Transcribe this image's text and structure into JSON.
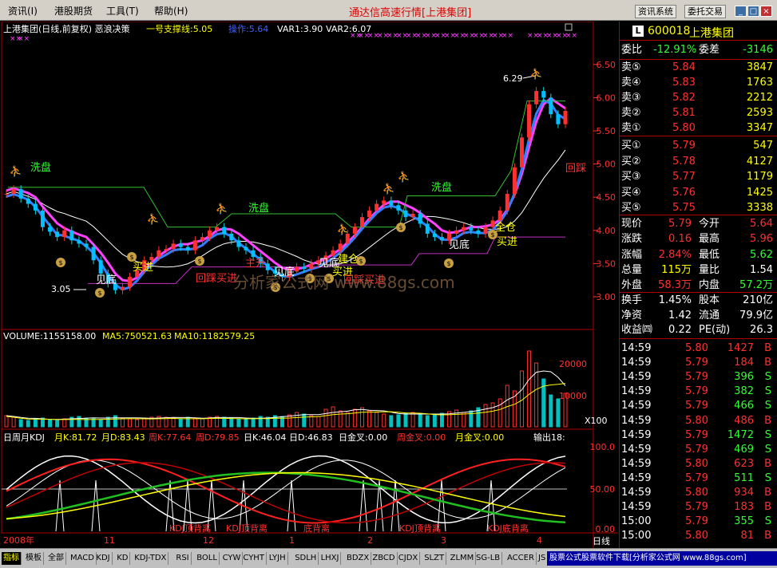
{
  "menubar": {
    "items": [
      "资讯(I)",
      "港股期货",
      "工具(T)",
      "帮助(H)"
    ],
    "title": "通达信高速行情[上港集团]",
    "btn_news": "资讯系统",
    "btn_trade": "委托交易",
    "btn_min": "_",
    "btn_max": "□",
    "btn_close": "×"
  },
  "chart": {
    "header": "上港集团(日线,前复权) 恶浪决策",
    "support_line": "一号支撑线:5.05",
    "operate": "操作:5.64",
    "var1": "VAR1:3.90",
    "var2": "VAR2:6.07",
    "price_axis": [
      "6.50",
      "6.00",
      "5.50",
      "5.00",
      "4.50",
      "4.00",
      "3.50",
      "3.00"
    ],
    "high_label": "6.29",
    "low_label": "3.05",
    "annotations": {
      "xipan": "洗盘",
      "jiandi": "见底",
      "maijin": "买进",
      "huicai": "回踩买进",
      "zhusheng": "主升",
      "jiancang": "建仓",
      "quancang": "全仓",
      "huicai_right": "回踩"
    },
    "watermark": "分析家公式网 www.88gs.com",
    "volume": {
      "header_vol": "VOLUME:1155158.00",
      "header_ma5": "MA5:750521.63",
      "header_ma10": "MA10:1182579.25",
      "axis": [
        "20000",
        "10000"
      ],
      "unit": "X100"
    },
    "kdj": {
      "title": "日周月KDJ",
      "k_month": "月K:81.72",
      "d_month": "月D:83.43",
      "k_week": "周K:77.64",
      "d_week": "周D:79.85",
      "k_day": "日K:46.04",
      "d_day": "日D:46.83",
      "gold_day": "日金叉:0.00",
      "gold_week": "周金叉:0.00",
      "gold_month": "月金叉:0.00",
      "output": "输出18:",
      "axis": [
        "100.0",
        "50.00",
        "0.00"
      ],
      "notes": [
        "KDJ顶背离",
        "KDJ顶背离",
        "底背离",
        "KDJ顶背离",
        "KDJ底背离"
      ]
    },
    "date_axis": [
      "2008年",
      "11",
      "12",
      "1",
      "2",
      "3",
      "4"
    ],
    "period": "日线"
  },
  "quote": {
    "code": "600018",
    "name": "上港集团",
    "weibi_label": "委比",
    "weibi": "-12.91%",
    "weicha_label": "委差",
    "weicha": "-3146",
    "sell": [
      {
        "label": "卖⑤",
        "price": "5.84",
        "vol": "3847"
      },
      {
        "label": "卖④",
        "price": "5.83",
        "vol": "1763"
      },
      {
        "label": "卖③",
        "price": "5.82",
        "vol": "2212"
      },
      {
        "label": "卖②",
        "price": "5.81",
        "vol": "2593"
      },
      {
        "label": "卖①",
        "price": "5.80",
        "vol": "3347"
      }
    ],
    "buy": [
      {
        "label": "买①",
        "price": "5.79",
        "vol": "547"
      },
      {
        "label": "买②",
        "price": "5.78",
        "vol": "4127"
      },
      {
        "label": "买③",
        "price": "5.77",
        "vol": "1179"
      },
      {
        "label": "买④",
        "price": "5.76",
        "vol": "1425"
      },
      {
        "label": "买⑤",
        "price": "5.75",
        "vol": "3338"
      }
    ],
    "stats": [
      {
        "l1": "现价",
        "v1": "5.79",
        "l2": "今开",
        "v2": "5.64"
      },
      {
        "l1": "涨跌",
        "v1": "0.16",
        "l2": "最高",
        "v2": "5.96"
      },
      {
        "l1": "涨幅",
        "v1": "2.84%",
        "l2": "最低",
        "v2": "5.62"
      },
      {
        "l1": "总量",
        "v1": "115万",
        "l2": "量比",
        "v2": "1.54"
      },
      {
        "l1": "外盘",
        "v1": "58.3万",
        "l2": "内盘",
        "v2": "57.2万"
      }
    ],
    "fund": [
      {
        "l1": "换手",
        "v1": "1.45%",
        "l2": "股本",
        "v2": "210亿"
      },
      {
        "l1": "净资",
        "v1": "1.42",
        "l2": "流通",
        "v2": "79.9亿"
      },
      {
        "l1": "收益㈣",
        "v1": "0.22",
        "l2": "PE(动)",
        "v2": "26.3"
      }
    ],
    "ticks": [
      {
        "t": "14:59",
        "p": "5.80",
        "v": "1427",
        "s": "B"
      },
      {
        "t": "14:59",
        "p": "5.79",
        "v": "184",
        "s": "B"
      },
      {
        "t": "14:59",
        "p": "5.79",
        "v": "396",
        "s": "S"
      },
      {
        "t": "14:59",
        "p": "5.79",
        "v": "382",
        "s": "S"
      },
      {
        "t": "14:59",
        "p": "5.79",
        "v": "466",
        "s": "S"
      },
      {
        "t": "14:59",
        "p": "5.80",
        "v": "486",
        "s": "B"
      },
      {
        "t": "14:59",
        "p": "5.79",
        "v": "1472",
        "s": "S"
      },
      {
        "t": "14:59",
        "p": "5.79",
        "v": "469",
        "s": "S"
      },
      {
        "t": "14:59",
        "p": "5.80",
        "v": "623",
        "s": "B"
      },
      {
        "t": "14:59",
        "p": "5.79",
        "v": "511",
        "s": "S"
      },
      {
        "t": "14:59",
        "p": "5.80",
        "v": "934",
        "s": "B"
      },
      {
        "t": "14:59",
        "p": "5.79",
        "v": "183",
        "s": "B"
      },
      {
        "t": "15:00",
        "p": "5.79",
        "v": "355",
        "s": "S"
      },
      {
        "t": "15:00",
        "p": "5.80",
        "v": "81",
        "s": "B"
      }
    ]
  },
  "tabs": [
    "指标",
    "模板",
    "全部",
    "MACD",
    "KDJ",
    "KD",
    "KDJ-TDX",
    "RSI",
    "BOLL",
    "CYW",
    "CYHT",
    "LYJH",
    "SDLH",
    "LHXJ",
    "BDZX",
    "ZBCD",
    "CJDX",
    "SLZT",
    "ZLMM",
    "SG-LB",
    "ACCER",
    "JS"
  ],
  "status": "股票公式股票软件下载[分析家公式网 www.88gs.com]",
  "colors": {
    "up": "#ff3030",
    "down": "#00e0e0",
    "bg": "#000000",
    "border": "#b00000"
  }
}
